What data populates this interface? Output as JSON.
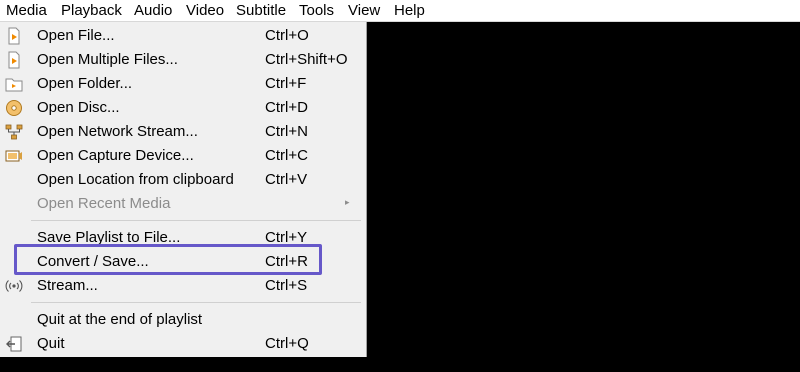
{
  "menubar": {
    "items": [
      "Media",
      "Playback",
      "Audio",
      "Video",
      "Subtitle",
      "Tools",
      "View",
      "Help"
    ]
  },
  "menu": {
    "items": [
      {
        "label": "Open File...",
        "shortcut": "Ctrl+O",
        "icon": "file-icon"
      },
      {
        "label": "Open Multiple Files...",
        "shortcut": "Ctrl+Shift+O",
        "icon": "multiple-files-icon"
      },
      {
        "label": "Open Folder...",
        "shortcut": "Ctrl+F",
        "icon": "folder-icon"
      },
      {
        "label": "Open Disc...",
        "shortcut": "Ctrl+D",
        "icon": "disc-icon"
      },
      {
        "label": "Open Network Stream...",
        "shortcut": "Ctrl+N",
        "icon": "network-icon"
      },
      {
        "label": "Open Capture Device...",
        "shortcut": "Ctrl+C",
        "icon": "capture-device-icon"
      },
      {
        "label": "Open Location from clipboard",
        "shortcut": "Ctrl+V"
      },
      {
        "label": "Open Recent Media",
        "disabled": true,
        "submenu": true,
        "arrow": "▸"
      },
      {
        "label": "Save Playlist to File...",
        "shortcut": "Ctrl+Y"
      },
      {
        "label": "Convert / Save...",
        "shortcut": "Ctrl+R"
      },
      {
        "label": "Stream...",
        "shortcut": "Ctrl+S",
        "icon": "stream-icon"
      },
      {
        "label": "Quit at the end of playlist"
      },
      {
        "label": "Quit",
        "shortcut": "Ctrl+Q",
        "icon": "quit-icon"
      }
    ]
  },
  "colors": {
    "highlight_border": "#6658c9",
    "menu_background": "#f0f0f0",
    "video_background": "#000000",
    "disabled_text": "#8c8c8c"
  }
}
